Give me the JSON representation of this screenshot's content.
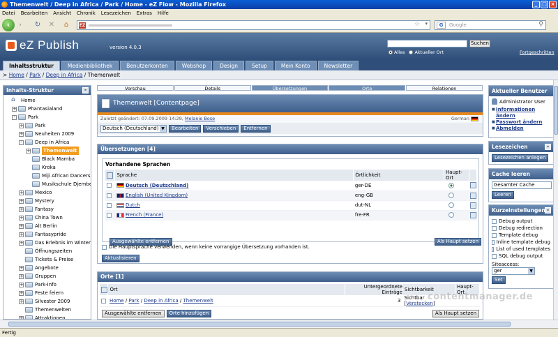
{
  "window": {
    "title": "Themenwelt / Deep in Africa / Park / Home - eZ Flow - Mozilla Firefox"
  },
  "menubar": [
    "Datei",
    "Bearbeiten",
    "Ansicht",
    "Chronik",
    "Lesezeichen",
    "Extras",
    "Hilfe"
  ],
  "browser": {
    "search_placeholder": "Google",
    "status": "Fertig"
  },
  "ez": {
    "logo": "eZ Publish",
    "version": "version 4.0.3",
    "search_button": "Suchen",
    "radio_all": "Alles",
    "radio_current": "Aktueller Ort",
    "advanced": "Fortgeschritten",
    "tabs": [
      "Inhaltsstruktur",
      "Medienbibliothek",
      "Benutzerkonten",
      "Webshop",
      "Design",
      "Setup",
      "Mein Konto",
      "Newsletter"
    ],
    "breadcrumb": {
      "sep": ">",
      "items": [
        "Home",
        "Park",
        "Deep in Africa"
      ],
      "current": "Themenwelt"
    }
  },
  "tree": {
    "title": "Inhalts-Struktur",
    "items": [
      {
        "label": "Home",
        "depth": 0,
        "type": "home",
        "exp": ""
      },
      {
        "label": "Phantasialand",
        "depth": 1,
        "type": "folder",
        "exp": "+"
      },
      {
        "label": "Park",
        "depth": 1,
        "type": "folder",
        "exp": "-"
      },
      {
        "label": "Park",
        "depth": 2,
        "type": "folder",
        "exp": "+"
      },
      {
        "label": "Neuheiten 2009",
        "depth": 2,
        "type": "folder",
        "exp": "+"
      },
      {
        "label": "Deep in Africa",
        "depth": 2,
        "type": "folder",
        "exp": "-"
      },
      {
        "label": "Themenwelt",
        "depth": 3,
        "type": "folder",
        "exp": "+",
        "selected": true
      },
      {
        "label": "Black Mamba",
        "depth": 3,
        "type": "folder",
        "exp": ""
      },
      {
        "label": "Kroka",
        "depth": 3,
        "type": "folder",
        "exp": ""
      },
      {
        "label": "Miji African Dancers",
        "depth": 3,
        "type": "folder",
        "exp": ""
      },
      {
        "label": "Musikschule Djembe",
        "depth": 3,
        "type": "folder",
        "exp": ""
      },
      {
        "label": "Mexico",
        "depth": 2,
        "type": "folder",
        "exp": "+"
      },
      {
        "label": "Mystery",
        "depth": 2,
        "type": "folder",
        "exp": "+"
      },
      {
        "label": "Fantasy",
        "depth": 2,
        "type": "folder",
        "exp": "+"
      },
      {
        "label": "China Town",
        "depth": 2,
        "type": "folder",
        "exp": "+"
      },
      {
        "label": "Alt Berlin",
        "depth": 2,
        "type": "folder",
        "exp": "+"
      },
      {
        "label": "Fantasypride",
        "depth": 2,
        "type": "folder",
        "exp": "+"
      },
      {
        "label": "Das Erlebnis im Winter",
        "depth": 2,
        "type": "folder",
        "exp": "+"
      },
      {
        "label": "Öffnungszeiten",
        "depth": 2,
        "type": "folder",
        "exp": ""
      },
      {
        "label": "Tickets & Preise",
        "depth": 2,
        "type": "folder",
        "exp": ""
      },
      {
        "label": "Angebote",
        "depth": 2,
        "type": "folder",
        "exp": "+"
      },
      {
        "label": "Gruppen",
        "depth": 2,
        "type": "folder",
        "exp": "+"
      },
      {
        "label": "Park-Info",
        "depth": 2,
        "type": "folder",
        "exp": "+"
      },
      {
        "label": "Feste feiern",
        "depth": 2,
        "type": "folder",
        "exp": "+"
      },
      {
        "label": "Silvester 2009",
        "depth": 2,
        "type": "folder",
        "exp": "+"
      },
      {
        "label": "Themenwelten",
        "depth": 2,
        "type": "folder",
        "exp": ""
      },
      {
        "label": "Attraktionen",
        "depth": 2,
        "type": "folder",
        "exp": "+"
      }
    ]
  },
  "viewtabs": [
    "Vorschau",
    "Details",
    "Übersetzungen",
    "Orte",
    "Relationen"
  ],
  "contentpage": {
    "title": "Themenwelt [Contentpage]",
    "modified_prefix": "Zuletzt geändert: 07.09.2009 14:29,",
    "modified_by": "Melanie Bose",
    "lang": "German",
    "lang_select": "Deutsch (Deutschland)",
    "btn_edit": "Bearbeiten",
    "btn_move": "Verschieben",
    "btn_remove": "Entfernen"
  },
  "translations": {
    "title": "Übersetzungen [4]",
    "subtitle": "Vorhandene Sprachen",
    "headers": {
      "language": "Sprache",
      "locale": "Örtlichkeit",
      "main": "Haupt-Ort"
    },
    "rows": [
      {
        "name": "Deutsch (Deutschland)",
        "locale": "ger-DE",
        "flag": "de",
        "main": true,
        "bold": true
      },
      {
        "name": "English (United Kingdom)",
        "locale": "eng-GB",
        "flag": "gb",
        "main": false,
        "bold": false
      },
      {
        "name": "Dutch",
        "locale": "dut-NL",
        "flag": "nl",
        "main": false,
        "bold": false
      },
      {
        "name": "French (France)",
        "locale": "fre-FR",
        "flag": "fr",
        "main": false,
        "bold": false
      }
    ],
    "btn_remove_selected": "Ausgewählte entfernen",
    "btn_set_main": "Als Haupt setzen",
    "default_lang_text": "Die Hauptsprache verwenden, wenn keine vorrangige Übersetzung vorhanden ist.",
    "btn_update": "Aktualisieren"
  },
  "orte": {
    "title": "Orte [1]",
    "headers": {
      "place": "Ort",
      "children": "Untergeordnete Einträge",
      "visibility": "Sichtbarkeit",
      "main": "Haupt-Ort"
    },
    "row": {
      "path": [
        "Home",
        "Park",
        "Deep in Africa",
        "Themenwelt"
      ],
      "children": "3",
      "visibility_prefix": "Sichtbar [",
      "visibility_link": "Verstecken",
      "visibility_suffix": "]"
    },
    "btn_remove_selected": "Ausgewählte entfernen",
    "btn_add": "Orte hinzufügen",
    "btn_set_main": "Als Haupt setzen"
  },
  "right": {
    "current_user": {
      "title": "Aktueller Benutzer",
      "name": "Administrator User",
      "links": [
        "Informationen ändern",
        "Passwort ändern",
        "Abmelden"
      ]
    },
    "bookmarks": {
      "title": "Lesezeichen",
      "button": "Lesezeichen anlegen"
    },
    "cache": {
      "title": "Cache leeren",
      "select": "Gesamter Cache",
      "button": "Leeren"
    },
    "quick": {
      "title": "Kurzeinstellungen",
      "options": [
        "Debug output",
        "Debug redirection",
        "Template debug",
        "Inline template debug",
        "List of used templates",
        "SQL debug output"
      ],
      "siteaccess_label": "Siteaccess:",
      "siteaccess_value": "ger",
      "button": "Set"
    }
  },
  "watermark": "contentmanager.de",
  "colors": {
    "accent": "#3f5f8c",
    "highlight": "#f29b1d",
    "orange_band": "#e8891d"
  }
}
